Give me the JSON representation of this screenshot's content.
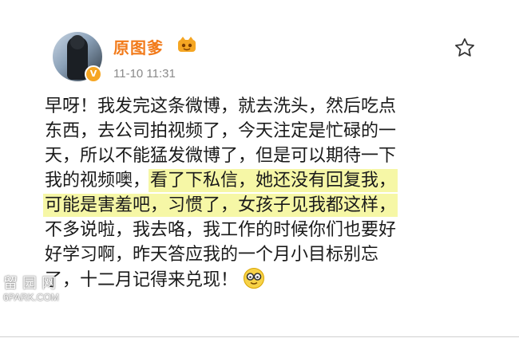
{
  "post": {
    "author": {
      "name": "原图爹",
      "verified_badge": "V"
    },
    "timestamp": "11-10 11:31",
    "favorite_icon": "star-outline-icon",
    "lines": [
      {
        "segments": [
          {
            "text": "早呀！我发完这条微博，就去洗头，然后吃点",
            "highlight": false
          }
        ]
      },
      {
        "segments": [
          {
            "text": "东西，去公司拍视频了，今天注定是忙碌的一",
            "highlight": false
          }
        ]
      },
      {
        "segments": [
          {
            "text": "天，所以不能猛发微博了，但是可以期待一下",
            "highlight": false
          }
        ]
      },
      {
        "segments": [
          {
            "text": "我的视频噢，",
            "highlight": false
          },
          {
            "text": "看了下私信，她还没有回复我，",
            "highlight": true
          }
        ]
      },
      {
        "segments": [
          {
            "text": "可能是害羞吧，习惯了，女孩子见我都这样，",
            "highlight": true
          }
        ]
      },
      {
        "segments": [
          {
            "text": "不多说啦，我去咯，我工作的时候你们也要好",
            "highlight": false
          }
        ]
      },
      {
        "segments": [
          {
            "text": "好学习啊，昨天答应我的一个月小目标别忘",
            "highlight": false
          }
        ]
      },
      {
        "segments": [
          {
            "text": "了，十二月记得来兑现！",
            "highlight": false
          }
        ]
      }
    ],
    "emoji": "nerd-glasses-emoji"
  },
  "watermark": {
    "line1": "留园网",
    "line2": "6PARK.COM"
  },
  "colors": {
    "username": "#f27b1b",
    "highlight": "#f6f7a6",
    "timestamp": "#8a8a8a",
    "badge": "#f6a623"
  }
}
